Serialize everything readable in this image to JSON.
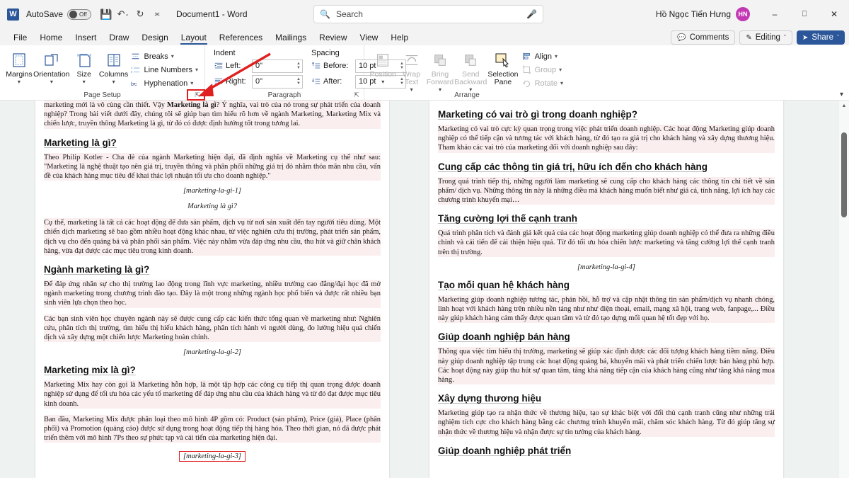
{
  "titlebar": {
    "app_logo": "W",
    "autosave_label": "AutoSave",
    "autosave_state": "Off",
    "save_icon": "save-icon",
    "undo_icon": "undo-icon",
    "redo_icon": "redo-icon",
    "customize_icon": "customize-quick-access-icon",
    "document_title": "Document1  -  Word",
    "search_placeholder": "Search",
    "search_icon": "search-icon",
    "mic_icon": "microphone-icon",
    "user_name": "Hồ Ngọc Tiến Hưng",
    "user_initials": "HN",
    "minimize": "–",
    "restore": "❐",
    "close": "✕"
  },
  "tabs": [
    {
      "label": "File",
      "active": false
    },
    {
      "label": "Home",
      "active": false
    },
    {
      "label": "Insert",
      "active": false
    },
    {
      "label": "Draw",
      "active": false
    },
    {
      "label": "Design",
      "active": false
    },
    {
      "label": "Layout",
      "active": true
    },
    {
      "label": "References",
      "active": false
    },
    {
      "label": "Mailings",
      "active": false
    },
    {
      "label": "Review",
      "active": false
    },
    {
      "label": "View",
      "active": false
    },
    {
      "label": "Help",
      "active": false
    }
  ],
  "tabbar_right": {
    "comments_label": "Comments",
    "comments_icon": "comment-icon",
    "editing_label": "Editing",
    "editing_icon": "pencil-icon",
    "share_label": "Share",
    "share_icon": "share-icon",
    "chevron": "ˇ"
  },
  "ribbon": {
    "collapse_icon": "chevron-down-icon",
    "groups": [
      {
        "name": "Page Setup",
        "label": "Page Setup",
        "has_launcher": true,
        "launcher_highlighted": true,
        "big_buttons": [
          {
            "label": "Margins",
            "icon": "margins-icon",
            "has_chevron": true
          },
          {
            "label": "Orientation",
            "icon": "orientation-icon",
            "has_chevron": true
          },
          {
            "label": "Size",
            "icon": "size-icon",
            "has_chevron": true
          },
          {
            "label": "Columns",
            "icon": "columns-icon",
            "has_chevron": true
          }
        ],
        "small_buttons": [
          {
            "label": "Breaks",
            "icon": "breaks-icon",
            "has_chevron": true
          },
          {
            "label": "Line Numbers",
            "icon": "line-numbers-icon",
            "has_chevron": true
          },
          {
            "label": "Hyphenation",
            "icon": "hyphenation-icon",
            "has_chevron": true
          }
        ]
      },
      {
        "name": "Paragraph",
        "label": "Paragraph",
        "has_launcher": true,
        "indent_header": "Indent",
        "spacing_header": "Spacing",
        "fields": [
          {
            "label": "Left:",
            "value": "0\"",
            "icon": "indent-left-icon"
          },
          {
            "label": "Right:",
            "value": "0\"",
            "icon": "indent-right-icon"
          },
          {
            "label": "Before:",
            "value": "10 pt",
            "icon": "spacing-before-icon"
          },
          {
            "label": "After:",
            "value": "10 pt",
            "icon": "spacing-after-icon"
          }
        ]
      },
      {
        "name": "Arrange",
        "label": "Arrange",
        "has_launcher": false,
        "big_buttons": [
          {
            "label": "Position",
            "icon": "position-icon",
            "has_chevron": true,
            "disabled": true
          },
          {
            "label": "Wrap Text",
            "icon": "wrap-text-icon",
            "has_chevron": true,
            "disabled": true
          },
          {
            "label": "Bring Forward",
            "icon": "bring-forward-icon",
            "has_chevron": true,
            "disabled": true
          },
          {
            "label": "Send Backward",
            "icon": "send-backward-icon",
            "has_chevron": true,
            "disabled": true
          },
          {
            "label": "Selection Pane",
            "icon": "selection-pane-icon",
            "has_chevron": false,
            "disabled": false
          }
        ],
        "small_buttons": [
          {
            "label": "Align",
            "icon": "align-icon",
            "has_chevron": true,
            "disabled": false
          },
          {
            "label": "Group",
            "icon": "group-icon",
            "has_chevron": true,
            "disabled": true
          },
          {
            "label": "Rotate",
            "icon": "rotate-icon",
            "has_chevron": true,
            "disabled": true
          }
        ]
      }
    ]
  },
  "document": {
    "left_page": {
      "blocks": [
        {
          "type": "paragraph",
          "html": "marketing mới là vô cùng cần thiết. Vậy <b>Marketing là gì</b>? Ý nghĩa, vai trò của nó trong sự phát triển của doanh nghiệp? Trong bài viết dưới đây, chúng tôi sẽ giúp bạn tìm hiểu rõ hơn về ngành Marketing, Marketing Mix và chiến lược, truyền thông Marketing là gì, từ đó có được định hướng tốt trong tương lai."
        },
        {
          "type": "heading",
          "text": "Marketing là gì?"
        },
        {
          "type": "paragraph",
          "html": "Theo Philip Kotler - Cha đẻ của ngành Marketing hiện đại, đã định nghĩa về Marketing cụ thể như sau: \"Marketing là nghệ thuật tạo nên giá trị, truyền thông và phân phối những giá trị đó nhằm thỏa mãn nhu cầu, vấn đề của khách hàng mục tiêu để khai thác lợi nhuận tối ưu cho doanh nghiệp.\""
        },
        {
          "type": "caption",
          "text": "[marketing-la-gi-1]"
        },
        {
          "type": "caption",
          "text": "Marketing là gì?"
        },
        {
          "type": "paragraph",
          "html": "Cụ thể, marketing là tất cả các hoạt động để đưa sản phẩm, dịch vụ từ nơi sản xuất đến tay người tiêu dùng. Một chiến dịch marketing sẽ bao gồm nhiều hoạt động khác nhau, từ việc nghiên cứu thị trường, phát triển sản phẩm, dịch vụ cho đến quảng bá và phân phối sản phẩm.  Việc này nhằm vừa đáp ứng nhu cầu, thu hút và giữ chân khách hàng, vừa đạt được các mục tiêu trong kinh doanh."
        },
        {
          "type": "heading",
          "text": "Ngành marketing là gì?"
        },
        {
          "type": "paragraph",
          "html": "Để đáp ứng nhân sự cho thị trường lao động trong lĩnh vực marketing, nhiều trường cao đẳng/đại học đã mở ngành marketing trong chương trình đào tạo. Đây là một trong những ngành học phổ biến và được rất nhiều bạn sinh viên lựa chọn theo học."
        },
        {
          "type": "paragraph",
          "html": "Các bạn sinh viên học chuyên ngành này sẽ được cung cấp các kiến thức tổng quan về marketing như: Nghiên cứu, phân tích thị trường, tìm hiểu thị hiếu khách hàng, phân tích hành vi người dùng, đo lường hiệu quả chiến dịch và xây dựng một chiến lược Marketing hoàn chỉnh."
        },
        {
          "type": "caption",
          "text": "[marketing-la-gi-2]"
        },
        {
          "type": "heading",
          "text": "Marketing mix là gì?"
        },
        {
          "type": "paragraph",
          "html": "Marketing Mix hay còn gọi là Marketing hỗn hợp, là một tập hợp các công cụ tiếp thị quan trọng được doanh nghiệp sử dụng để tối ưu hóa các yếu tố marketing để đáp ứng nhu cầu của khách hàng và từ đó đạt được mục tiêu kinh doanh."
        },
        {
          "type": "paragraph",
          "html": "Ban đầu, Marketing Mix được phân loại theo mô hình 4P gồm có: Product (sản phẩm), Price (giá), Place (phân phối) và Promotion (quảng cáo) được sử dụng trong hoạt động tiếp thị hàng hóa. Theo thời gian, nó đã được phát triển thêm với mô hình 7Ps theo sự phức tạp và cải tiến của marketing hiện đại."
        },
        {
          "type": "caption-boxed",
          "text": "[marketing-la-gi-3]"
        }
      ]
    },
    "right_page": {
      "blocks": [
        {
          "type": "heading",
          "text": "Marketing có vai trò gì trong doanh nghiệp?"
        },
        {
          "type": "paragraph",
          "html": "Marketing có vai trò cực kỳ quan trọng trong việc phát triển doanh nghiệp. Các hoạt động Marketing giúp doanh nghiệp có thể tiếp cận và tương tác với khách hàng, từ đó tạo ra giá trị cho khách hàng và xây dựng thương hiệu. Tham khảo các vai trò của marketing đối với doanh nghiệp sau đây:"
        },
        {
          "type": "heading",
          "text": "Cung cấp các thông tin giá trị, hữu ích đến cho khách hàng"
        },
        {
          "type": "paragraph",
          "html": "Trong quá trình tiếp thị, những người làm marketing sẽ cung cấp cho khách hàng các thông tin chi tiết về sản phẩm/ dịch vụ. Những thông tin này là những điều mà khách hàng muốn biết như giá cả, tính năng, lợi ích hay các chương trình khuyến mại…"
        },
        {
          "type": "heading",
          "text": "Tăng cường lợi thế cạnh tranh"
        },
        {
          "type": "paragraph",
          "html": "Quá trình phân tích và đánh giá kết quả của các hoạt động marketing giúp doanh nghiệp có thể đưa ra những điều chỉnh và cải tiến để cải thiện hiệu quả. Từ đó tối ưu hóa chiến lược marketing và tăng cường lợi thế cạnh tranh trên thị trường."
        },
        {
          "type": "caption",
          "text": "[marketing-la-gi-4]"
        },
        {
          "type": "heading",
          "text": "Tạo mối quan hệ khách hàng"
        },
        {
          "type": "paragraph",
          "html": "Marketing giúp doanh nghiệp tương tác, phản hồi, hỗ trợ và cập nhật thông tin sản phẩm/dịch vụ nhanh chóng, linh hoạt với khách hàng trên nhiều nền tảng như như điện thoại, email, mạng xã hội, trang web, fanpage,... Điều này giúp khách hàng cảm thấy được quan tâm và từ đó tạo dựng mối quan hệ tốt đẹp với họ."
        },
        {
          "type": "heading",
          "text": "Giúp doanh nghiệp bán hàng"
        },
        {
          "type": "paragraph",
          "html": "Thông qua việc tìm hiểu thị trường, marketing sẽ giúp xác định được các đối tượng khách hàng tiềm năng. Điều này giúp doanh nghiệp tập trung các hoạt động quảng bá, khuyến mãi và phát triển chiến lược bán hàng phù hợp. Các hoạt động này giúp thu hút sự quan tâm, tăng khả năng tiếp cận của khách hàng cũng như tăng khả năng mua hàng."
        },
        {
          "type": "heading",
          "text": "Xây dựng thương hiệu"
        },
        {
          "type": "paragraph",
          "html": "Marketing giúp tạo ra nhận thức về thương hiệu, tạo sự khác biệt với đối thủ cạnh tranh cũng như những trải nghiệm tích cực cho khách hàng bằng các chương trình khuyến mãi, chăm sóc khách hàng. Từ đó giúp tăng sự nhận thức về thương hiệu và nhận được sự tin tưởng của khách hàng."
        },
        {
          "type": "heading",
          "text": "Giúp doanh nghiệp phát triển"
        }
      ]
    }
  },
  "scrollbar": {
    "up_arrow": "▲",
    "down_arrow": "▼"
  },
  "colors": {
    "accent": "#2b579a",
    "annotation_red": "#e02020",
    "avatar": "#c239b3"
  }
}
